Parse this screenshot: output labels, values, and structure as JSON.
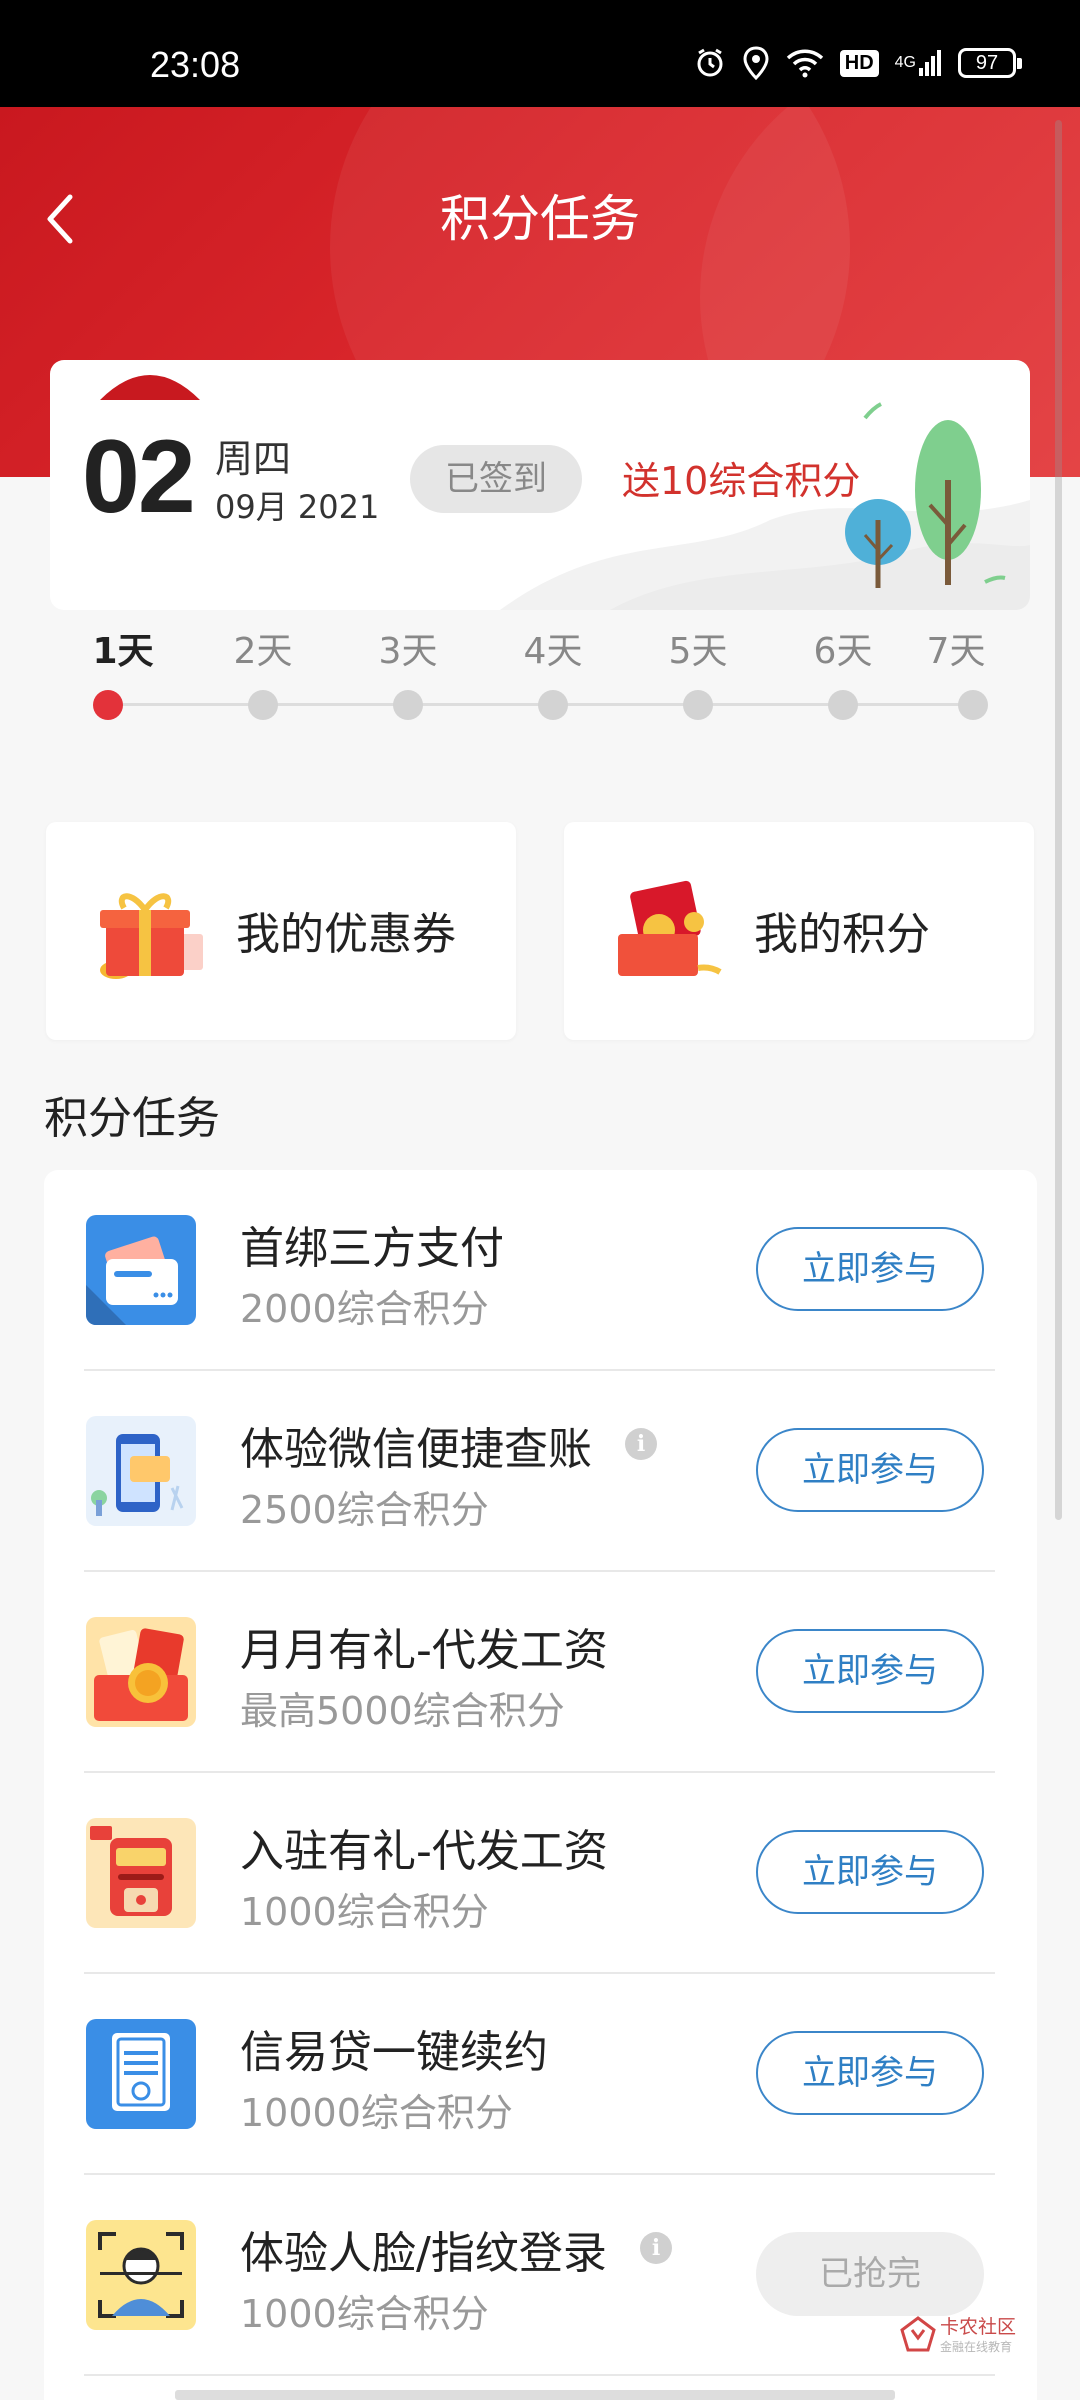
{
  "status_bar": {
    "time": "23:08",
    "network": "4G",
    "hd": "HD",
    "battery": "97"
  },
  "header": {
    "title": "积分任务",
    "back_label": "<"
  },
  "checkin": {
    "day": "02",
    "weekday": "周四",
    "month_year": "09月 2021",
    "status_badge": "已签到",
    "reward": "送10综合积分"
  },
  "progress": {
    "days": [
      "1天",
      "2天",
      "3天",
      "4天",
      "5天",
      "6天",
      "7天"
    ],
    "current_day_index": 0
  },
  "quick_links": {
    "coupons": "我的优惠券",
    "points": "我的积分"
  },
  "section_title": "积分任务",
  "tasks": [
    {
      "title": "首绑三方支付",
      "points": "2000综合积分",
      "button": "立即参与",
      "has_info": false,
      "enabled": true,
      "icon": "wallet-icon"
    },
    {
      "title": "体验微信便捷查账",
      "points": "2500综合积分",
      "button": "立即参与",
      "has_info": true,
      "enabled": true,
      "icon": "phone-chat-icon"
    },
    {
      "title": "月月有礼-代发工资",
      "points": "最高5000综合积分",
      "button": "立即参与",
      "has_info": false,
      "enabled": true,
      "icon": "red-envelope-icon"
    },
    {
      "title": "入驻有礼-代发工资",
      "points": "1000综合积分",
      "button": "立即参与",
      "has_info": false,
      "enabled": true,
      "icon": "mailbox-icon"
    },
    {
      "title": "信易贷一键续约",
      "points": "10000综合积分",
      "button": "立即参与",
      "has_info": false,
      "enabled": true,
      "icon": "contract-icon"
    },
    {
      "title": "体验人脸/指纹登录",
      "points": "1000综合积分",
      "button": "已抢完",
      "has_info": true,
      "enabled": false,
      "icon": "face-scan-icon"
    }
  ],
  "watermark": {
    "line1": "卡农社区",
    "line2": "金融在线教育"
  },
  "colors": {
    "brand_red": "#d9262b",
    "accent_blue": "#2f7fc4"
  }
}
